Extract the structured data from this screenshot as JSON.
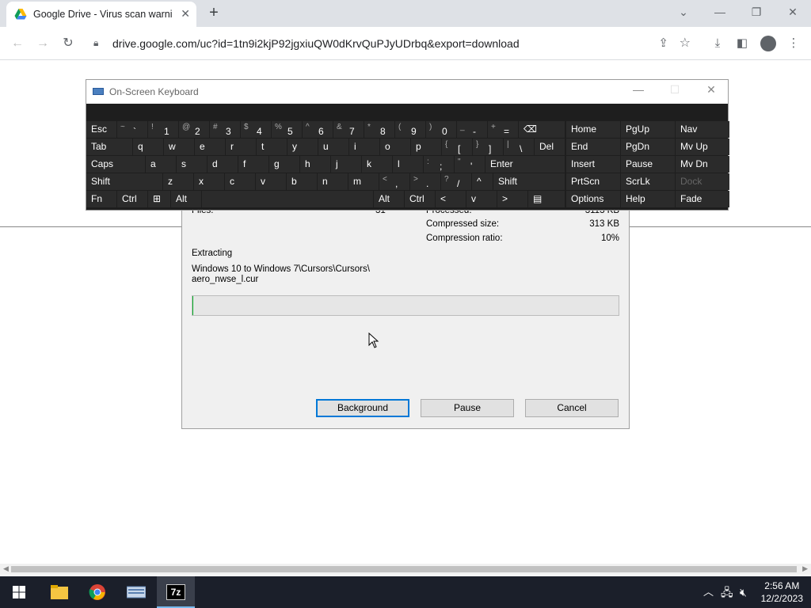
{
  "browser": {
    "tab_title": "Google Drive - Virus scan warning",
    "url": "drive.google.com/uc?id=1tn9i2kjP92jgxiuQW0dKrvQuPJyUDrbq&export=download"
  },
  "dialog": {
    "files_label": "Files:",
    "files_value": "31",
    "processed_label": "Processed:",
    "processed_value": "3113 KB",
    "compressed_label": "Compressed size:",
    "compressed_value": "313 KB",
    "ratio_label": "Compression ratio:",
    "ratio_value": "10%",
    "status_label": "Extracting",
    "current_path_1": "Windows 10 to Windows 7\\Cursors\\Cursors\\",
    "current_path_2": "aero_nwse_l.cur",
    "progress_fraction": 0.002,
    "buttons": {
      "background": "Background",
      "pause": "Pause",
      "cancel": "Cancel"
    }
  },
  "osk": {
    "title": "On-Screen Keyboard",
    "rows": [
      [
        {
          "l": "Esc"
        },
        {
          "s": "~",
          "m": "`"
        },
        {
          "s": "!",
          "m": "1"
        },
        {
          "s": "@",
          "m": "2"
        },
        {
          "s": "#",
          "m": "3"
        },
        {
          "s": "$",
          "m": "4"
        },
        {
          "s": "%",
          "m": "5"
        },
        {
          "s": "^",
          "m": "6"
        },
        {
          "s": "&",
          "m": "7"
        },
        {
          "s": "*",
          "m": "8"
        },
        {
          "s": "(",
          "m": "9"
        },
        {
          "s": ")",
          "m": "0"
        },
        {
          "s": "_",
          "m": "-"
        },
        {
          "s": "+",
          "m": "="
        },
        {
          "l": "⌫"
        },
        {
          "l": "Home"
        },
        {
          "l": "PgUp"
        },
        {
          "l": "Nav"
        }
      ],
      [
        {
          "l": "Tab"
        },
        {
          "l": "q"
        },
        {
          "l": "w"
        },
        {
          "l": "e"
        },
        {
          "l": "r"
        },
        {
          "l": "t"
        },
        {
          "l": "y"
        },
        {
          "l": "u"
        },
        {
          "l": "i"
        },
        {
          "l": "o"
        },
        {
          "l": "p"
        },
        {
          "s": "{",
          "m": "["
        },
        {
          "s": "}",
          "m": "]"
        },
        {
          "s": "|",
          "m": "\\"
        },
        {
          "l": "Del"
        },
        {
          "l": "End"
        },
        {
          "l": "PgDn"
        },
        {
          "l": "Mv Up"
        }
      ],
      [
        {
          "l": "Caps"
        },
        {
          "l": "a"
        },
        {
          "l": "s"
        },
        {
          "l": "d"
        },
        {
          "l": "f"
        },
        {
          "l": "g"
        },
        {
          "l": "h"
        },
        {
          "l": "j"
        },
        {
          "l": "k"
        },
        {
          "l": "l"
        },
        {
          "s": ":",
          "m": ";"
        },
        {
          "s": "\"",
          "m": "'"
        },
        {
          "l": "Enter"
        },
        {
          "l": "Insert"
        },
        {
          "l": "Pause"
        },
        {
          "l": "Mv Dn"
        }
      ],
      [
        {
          "l": "Shift"
        },
        {
          "l": "z"
        },
        {
          "l": "x"
        },
        {
          "l": "c"
        },
        {
          "l": "v"
        },
        {
          "l": "b"
        },
        {
          "l": "n"
        },
        {
          "l": "m"
        },
        {
          "s": "<",
          "m": ","
        },
        {
          "s": ">",
          "m": "."
        },
        {
          "s": "?",
          "m": "/"
        },
        {
          "l": "^"
        },
        {
          "l": "Shift"
        },
        {
          "l": "PrtScn"
        },
        {
          "l": "ScrLk"
        },
        {
          "l": "Dock"
        }
      ],
      [
        {
          "l": "Fn"
        },
        {
          "l": "Ctrl"
        },
        {
          "l": "⊞"
        },
        {
          "l": "Alt"
        },
        {
          "l": ""
        },
        {
          "l": "Alt"
        },
        {
          "l": "Ctrl"
        },
        {
          "l": "<"
        },
        {
          "l": "v"
        },
        {
          "l": ">"
        },
        {
          "l": "▤"
        },
        {
          "l": "Options"
        },
        {
          "l": "Help"
        },
        {
          "l": "Fade"
        }
      ]
    ]
  },
  "taskbar": {
    "time": "2:56 AM",
    "date": "12/2/2023",
    "apps": [
      "File Explorer",
      "Google Chrome",
      "On-Screen Keyboard",
      "7-Zip"
    ]
  },
  "colors": {
    "accent": "#0078d7",
    "progress": "#06b025",
    "osk_bg": "#1e1e1e",
    "taskbar": "#1b1f2a"
  }
}
